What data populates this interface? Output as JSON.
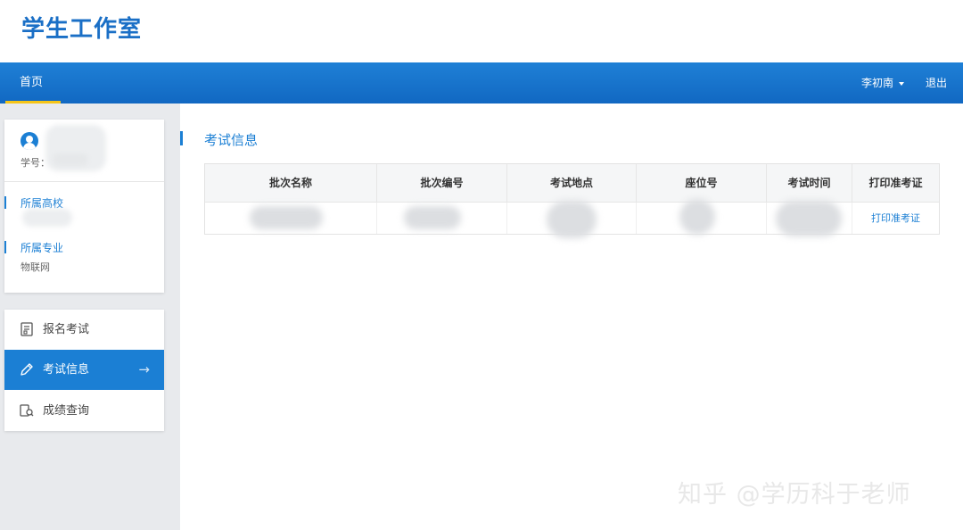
{
  "header": {
    "logo": "学生工作室"
  },
  "navbar": {
    "home": "首页",
    "user": "李初南",
    "logout": "退出"
  },
  "profile": {
    "sid_label": "学号：",
    "school_label": "所属高校",
    "major_label": "所属专业",
    "major_value": "物联网"
  },
  "menu": {
    "items": [
      {
        "label": "报名考试",
        "icon": "register-document-icon"
      },
      {
        "label": "考试信息",
        "icon": "pencil-icon"
      },
      {
        "label": "成绩查询",
        "icon": "score-query-icon"
      }
    ],
    "active_arrow": "→"
  },
  "content": {
    "title": "考试信息",
    "table": {
      "headers": [
        "批次名称",
        "批次编号",
        "考试地点",
        "座位号",
        "考试时间",
        "打印准考证"
      ],
      "rows": [
        {
          "print_link": "打印准考证"
        }
      ]
    }
  },
  "watermark": "知乎 @学历科于老师",
  "colors": {
    "primary": "#1b7fd4",
    "nav_gradient_top": "#1f80d6",
    "nav_gradient_bottom": "#1168c2",
    "home_underline": "#f5c518"
  }
}
